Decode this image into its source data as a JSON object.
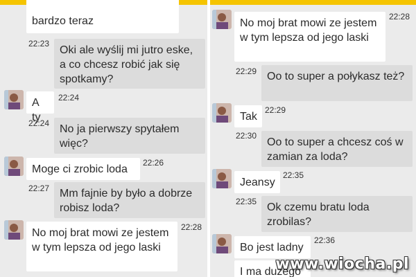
{
  "left": {
    "messages": [
      {
        "text": "bardzo teraz",
        "time": ""
      },
      {
        "text": "Oki ale wyślij mi jutro eske, a co chcesz robić jak się spotkamy?",
        "time": "22:23"
      },
      {
        "text": "A ty",
        "time": "22:24"
      },
      {
        "text": "No ja pierwszy spytałem więc?",
        "time": "22:24"
      },
      {
        "text": "Moge ci zrobic loda",
        "time": "22:26"
      },
      {
        "text": "Mm fajnie by było a dobrze robisz loda?",
        "time": "22:27"
      },
      {
        "text": "No moj brat mowi ze jestem w tym lepsza od jego laski",
        "time": "22:28"
      }
    ]
  },
  "right": {
    "messages": [
      {
        "text": "No moj brat mowi ze jestem w tym lepsza od jego laski",
        "time": "22:28"
      },
      {
        "text": "Oo to super a połykasz też?",
        "time": "22:29"
      },
      {
        "text": "Tak",
        "time": "22:29"
      },
      {
        "text": "Oo to super a chcesz coś w zamian za loda?",
        "time": "22:30"
      },
      {
        "text": "Jeansy",
        "time": "22:35"
      },
      {
        "text": "Ok czemu bratu loda zrobilas?",
        "time": "22:35"
      },
      {
        "text": "Bo jest ladny",
        "time": "22:36"
      },
      {
        "text": "I ma duzego",
        "time": ""
      }
    ]
  },
  "watermark": "www.wiocha.pl",
  "colors": {
    "topbar": "#f5c400",
    "incoming": "#ffffff",
    "outgoing": "#dcdcdc",
    "background": "#ebebeb"
  }
}
